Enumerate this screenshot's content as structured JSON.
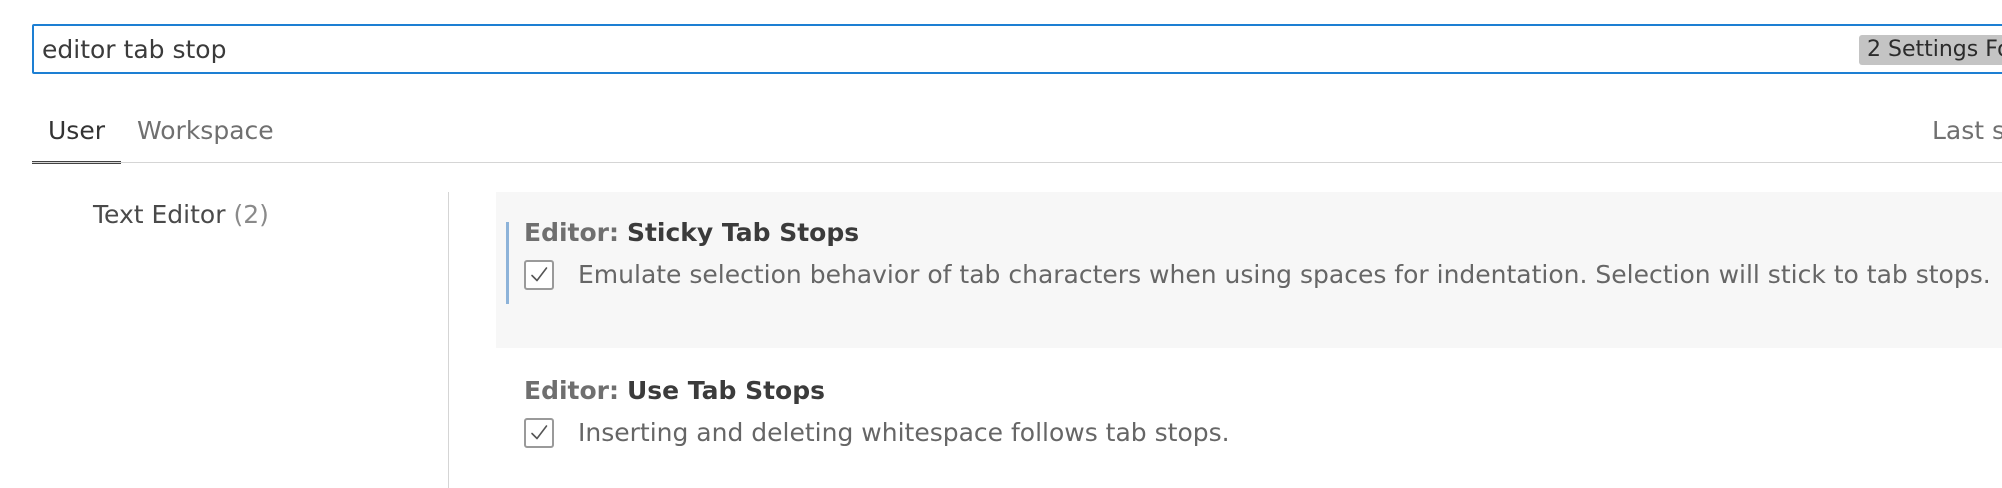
{
  "search": {
    "value": "editor tab stop",
    "placeholder": "Search settings",
    "results_badge": "2 Settings Fo"
  },
  "tabs": [
    {
      "label": "User",
      "active": true
    },
    {
      "label": "Workspace",
      "active": false
    }
  ],
  "last_synced": "Last s",
  "toc": {
    "items": [
      {
        "label": "Text Editor",
        "count": "(2)"
      }
    ]
  },
  "settings": [
    {
      "category": "Editor:",
      "name": "Sticky Tab Stops",
      "checked": true,
      "description": "Emulate selection behavior of tab characters when using spaces for indentation. Selection will stick to tab stops."
    },
    {
      "category": "Editor:",
      "name": "Use Tab Stops",
      "checked": true,
      "description": "Inserting and deleting whitespace follows tab stops."
    }
  ],
  "icons": {
    "checkbox_check": "checkmark-icon"
  },
  "colors": {
    "focus_border": "#1d7fd3",
    "focus_indicator": "#8db3d9",
    "selected_row_bg": "#f7f7f7"
  }
}
